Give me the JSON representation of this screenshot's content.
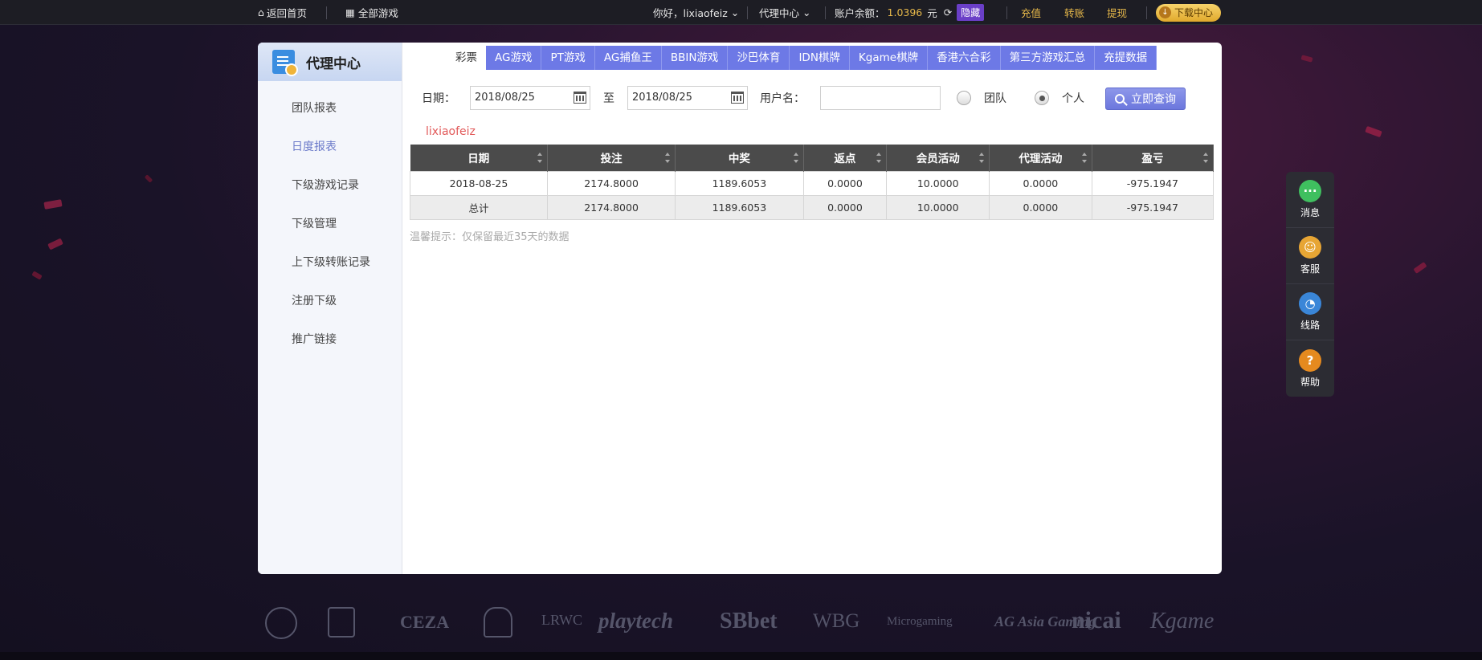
{
  "topbar": {
    "home": "返回首页",
    "all_games": "全部游戏",
    "greeting": "你好，lixiaofeiz",
    "agent_center": "代理中心",
    "balance_label": "账户余额：",
    "balance_value": "1.0396",
    "currency": "元",
    "hide": "隐藏",
    "deposit": "充值",
    "transfer": "转账",
    "withdraw": "提现",
    "download": "下载中心"
  },
  "sidebar": {
    "title": "代理中心",
    "items": [
      {
        "label": "团队报表"
      },
      {
        "label": "日度报表"
      },
      {
        "label": "下级游戏记录"
      },
      {
        "label": "下级管理"
      },
      {
        "label": "上下级转账记录"
      },
      {
        "label": "注册下级"
      },
      {
        "label": "推广链接"
      }
    ],
    "active_index": 1
  },
  "tabs": [
    {
      "label": "彩票"
    },
    {
      "label": "AG游戏"
    },
    {
      "label": "PT游戏"
    },
    {
      "label": "AG捕鱼王"
    },
    {
      "label": "BBIN游戏"
    },
    {
      "label": "沙巴体育"
    },
    {
      "label": "IDN棋牌"
    },
    {
      "label": "Kgame棋牌"
    },
    {
      "label": "香港六合彩"
    },
    {
      "label": "第三方游戏汇总"
    },
    {
      "label": "充提数据"
    }
  ],
  "filters": {
    "date_label": "日期：",
    "date_from": "2018/08/25",
    "to_label": "至",
    "date_to": "2018/08/25",
    "username_label": "用户名：",
    "username_value": "",
    "team_label": "团队",
    "personal_label": "个人",
    "query_button": "立即查询"
  },
  "report_user": "lixiaofeiz",
  "table": {
    "headers": [
      "日期",
      "投注",
      "中奖",
      "返点",
      "会员活动",
      "代理活动",
      "盈亏"
    ],
    "rows": [
      [
        "2018-08-25",
        "2174.8000",
        "1189.6053",
        "0.0000",
        "10.0000",
        "0.0000",
        "-975.1947"
      ]
    ],
    "total": [
      "总计",
      "2174.8000",
      "1189.6053",
      "0.0000",
      "10.0000",
      "0.0000",
      "-975.1947"
    ]
  },
  "tip": "温馨提示：仅保留最近35天的数据",
  "float_menu": [
    {
      "label": "消息",
      "icon": "message-icon",
      "color": "#3fbf5f"
    },
    {
      "label": "客服",
      "icon": "support-icon",
      "color": "#e7a534"
    },
    {
      "label": "线路",
      "icon": "route-icon",
      "color": "#3a86d8"
    },
    {
      "label": "帮助",
      "icon": "help-icon",
      "color": "#e58a1f"
    }
  ],
  "logos": [
    "CEZA",
    "playtech",
    "SBbet",
    "WBG",
    "Microgaming",
    "AG Asia Gaming",
    "nicai",
    "Kgame"
  ],
  "colors": {
    "tab_bg": "#6d79e6",
    "accent_gold": "#e6b84a",
    "header_dark": "#4b4b4b",
    "username_red": "#e25a5a"
  }
}
